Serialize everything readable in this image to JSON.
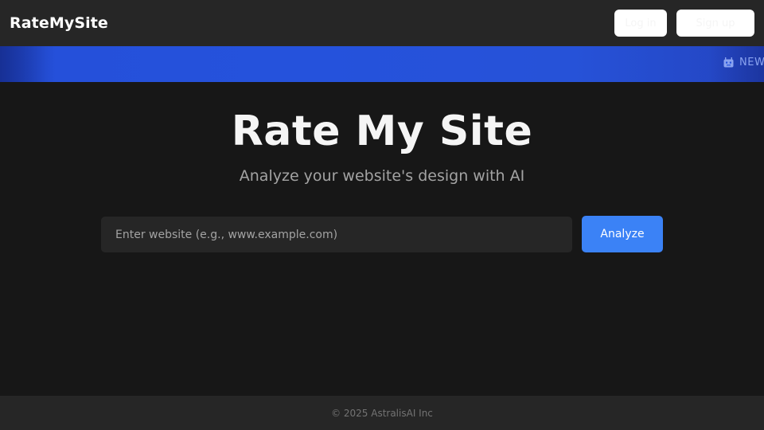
{
  "header": {
    "brand": "RateMySite",
    "login_label": "Log in",
    "signup_label": "Sign up"
  },
  "banner": {
    "ticker_icon": "robot-icon",
    "ticker_text": "NEW"
  },
  "hero": {
    "title": "Rate My Site",
    "subtitle": "Analyze your website's design with AI"
  },
  "form": {
    "input_value": "",
    "input_placeholder": "Enter website (e.g., www.example.com)",
    "button_label": "Analyze"
  },
  "footer": {
    "text": "© 2025 AstralisAI Inc"
  },
  "colors": {
    "background": "#171717",
    "header": "#262626",
    "banner": "#2552dc",
    "accent": "#3b82f6"
  }
}
